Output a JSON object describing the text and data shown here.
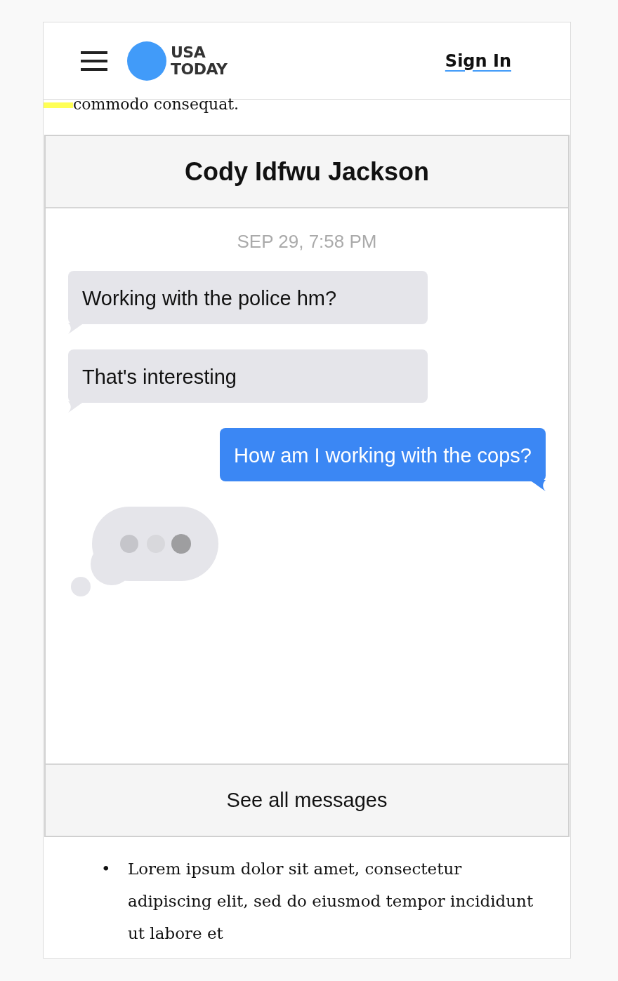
{
  "header": {
    "logo": {
      "line1": "USA",
      "line2": "TODAY"
    },
    "sign_in": "Sign In"
  },
  "article_top": {
    "text": "commodo consequat."
  },
  "conversation": {
    "title": "Cody Idfwu Jackson",
    "timestamp": "SEP 29, 7:58 PM",
    "messages": [
      {
        "kind": "received",
        "text": "Working with the police hm?"
      },
      {
        "kind": "received",
        "text": "That's interesting"
      },
      {
        "kind": "sent",
        "text": "How am I working with the cops?"
      }
    ],
    "typing": true,
    "footer": "See all messages"
  },
  "article_list_marker": "•",
  "article_list": [
    "Lorem ipsum dolor sit amet, consectetur adipiscing elit, sed do eiusmod tempor incididunt ut labore et"
  ]
}
